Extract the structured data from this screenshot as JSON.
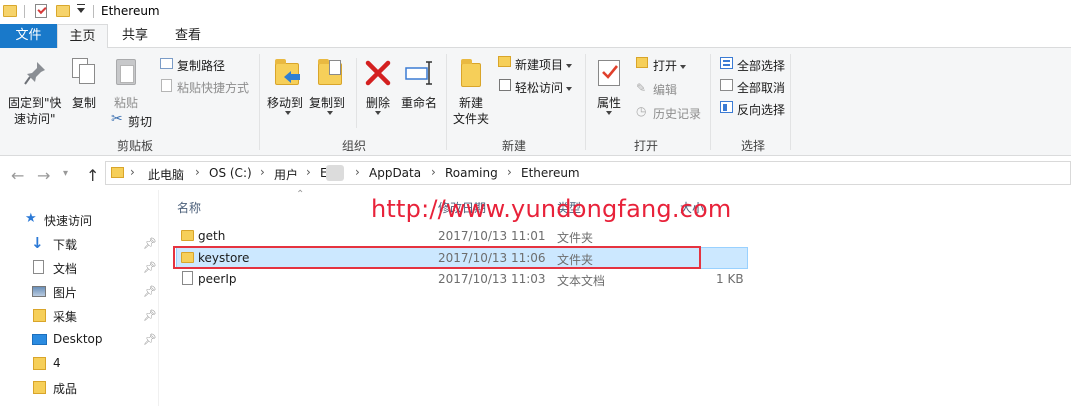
{
  "window": {
    "title": "Ethereum"
  },
  "tabs": {
    "file": "文件",
    "home": "主页",
    "share": "共享",
    "view": "查看"
  },
  "ribbon": {
    "pin_quick_access": "固定到\"快\n速访问\"",
    "pin_line1": "固定到\"快",
    "pin_line2": "速访问\"",
    "copy": "复制",
    "paste": "粘贴",
    "copy_path": "复制路径",
    "paste_shortcut": "粘贴快捷方式",
    "cut": "剪切",
    "clipboard_group": "剪贴板",
    "move_to": "移动到",
    "copy_to": "复制到",
    "delete": "删除",
    "rename": "重命名",
    "organize_group": "组织",
    "new_folder_line1": "新建",
    "new_folder_line2": "文件夹",
    "new_item": "新建项目",
    "easy_access": "轻松访问",
    "new_group": "新建",
    "properties": "属性",
    "open": "打开",
    "edit": "编辑",
    "history": "历史记录",
    "open_group": "打开",
    "select_all": "全部选择",
    "select_none": "全部取消",
    "invert_selection": "反向选择",
    "select_group": "选择"
  },
  "address": {
    "crumbs": [
      "此电脑",
      "OS (C:)",
      "用户",
      "E",
      "AppData",
      "Roaming",
      "Ethereum"
    ]
  },
  "nav": {
    "quick_access": "快速访问",
    "items": [
      {
        "label": "下载",
        "pinned": true
      },
      {
        "label": "文档",
        "pinned": true
      },
      {
        "label": "图片",
        "pinned": true
      },
      {
        "label": "采集",
        "pinned": true
      },
      {
        "label": "Desktop",
        "pinned": true
      },
      {
        "label": "4",
        "pinned": false
      },
      {
        "label": "成品",
        "pinned": false
      }
    ]
  },
  "columns": {
    "name": "名称",
    "date": "修改日期",
    "type": "类型",
    "size": "大小"
  },
  "files": [
    {
      "name": "geth",
      "date": "2017/10/13 11:01",
      "type": "文件夹",
      "size": "",
      "kind": "folder"
    },
    {
      "name": "keystore",
      "date": "2017/10/13 11:06",
      "type": "文件夹",
      "size": "",
      "kind": "folder",
      "selected": true
    },
    {
      "name": "peerIp",
      "date": "2017/10/13 11:03",
      "type": "文本文档",
      "size": "1 KB",
      "kind": "text"
    }
  ],
  "watermark": "http://www.yundongfang.com",
  "colors": {
    "accent": "#1979ca",
    "selection": "#cce8ff",
    "highlight_box": "#e53340",
    "watermark": "#e8223a"
  }
}
